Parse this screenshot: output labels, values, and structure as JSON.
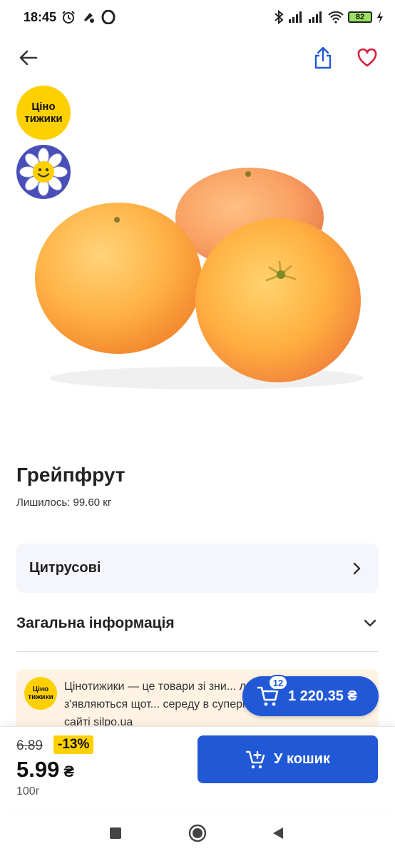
{
  "status_bar": {
    "time": "18:45",
    "battery_level": "82",
    "left_icons": [
      "alarm-icon",
      "notification-icon",
      "opera-icon"
    ],
    "right_icons": [
      "bluetooth-icon",
      "signal-icon",
      "signal-icon",
      "wifi-icon",
      "battery-icon",
      "charging-icon"
    ]
  },
  "header": {
    "back_icon": "arrow-left-icon",
    "share_icon": "share-icon",
    "favorite_icon": "heart-icon"
  },
  "badges": {
    "promo_line1": "Ціно",
    "promo_line2": "тижики",
    "daisy_icon": "daisy-smile-icon"
  },
  "product": {
    "title": "Грейпфрут",
    "stock": "Лишилось: 99.60 кг"
  },
  "category": {
    "label": "Цитрусові"
  },
  "general_info": {
    "label": "Загальна інформація"
  },
  "promo_info": {
    "badge_line1": "Ціно",
    "badge_line2": "тижики",
    "text": "Цінотижики — це товари зі зни... любите. Вони з'являються щот... середу в супермаркетах «Сільпо», на сайті silpo.ua"
  },
  "cart": {
    "count": "12",
    "total": "1 220.35 ₴"
  },
  "pricing": {
    "old_price": "6.89",
    "discount": "-13%",
    "price": "5.99",
    "currency": "₴",
    "unit": "100г",
    "add_button_label": "У кошик"
  },
  "colors": {
    "brand_blue": "#2158d6",
    "promo_yellow": "#ffd000",
    "heart_red": "#d4213d"
  }
}
